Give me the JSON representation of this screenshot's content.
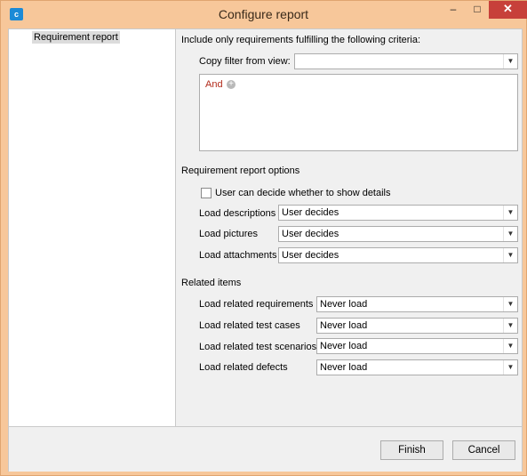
{
  "window": {
    "title": "Configure report",
    "app_icon": "app-icon",
    "controls": {
      "minimize": "–",
      "maximize": "□",
      "close": "✕"
    }
  },
  "nav": {
    "items": [
      {
        "label": "Requirement report"
      }
    ]
  },
  "criteria": {
    "heading": "Include only requirements fulfilling the following criteria:",
    "copy_filter_label": "Copy filter from view:",
    "copy_filter_value": "",
    "root_operator": "And",
    "add_icon": "plus-circle-icon"
  },
  "report_options": {
    "heading": "Requirement report options",
    "show_details_label": "User can decide whether to show details",
    "show_details_checked": false,
    "rows": [
      {
        "label": "Load descriptions",
        "value": "User decides"
      },
      {
        "label": "Load pictures",
        "value": "User decides"
      },
      {
        "label": "Load attachments",
        "value": "User decides"
      }
    ]
  },
  "related_items": {
    "heading": "Related items",
    "rows": [
      {
        "label": "Load related requirements",
        "value": "Never load"
      },
      {
        "label": "Load related test cases",
        "value": "Never load"
      },
      {
        "label": "Load related test scenarios",
        "value": "Never load"
      },
      {
        "label": "Load related defects",
        "value": "Never load"
      }
    ]
  },
  "buttons": {
    "finish": "Finish",
    "cancel": "Cancel"
  }
}
